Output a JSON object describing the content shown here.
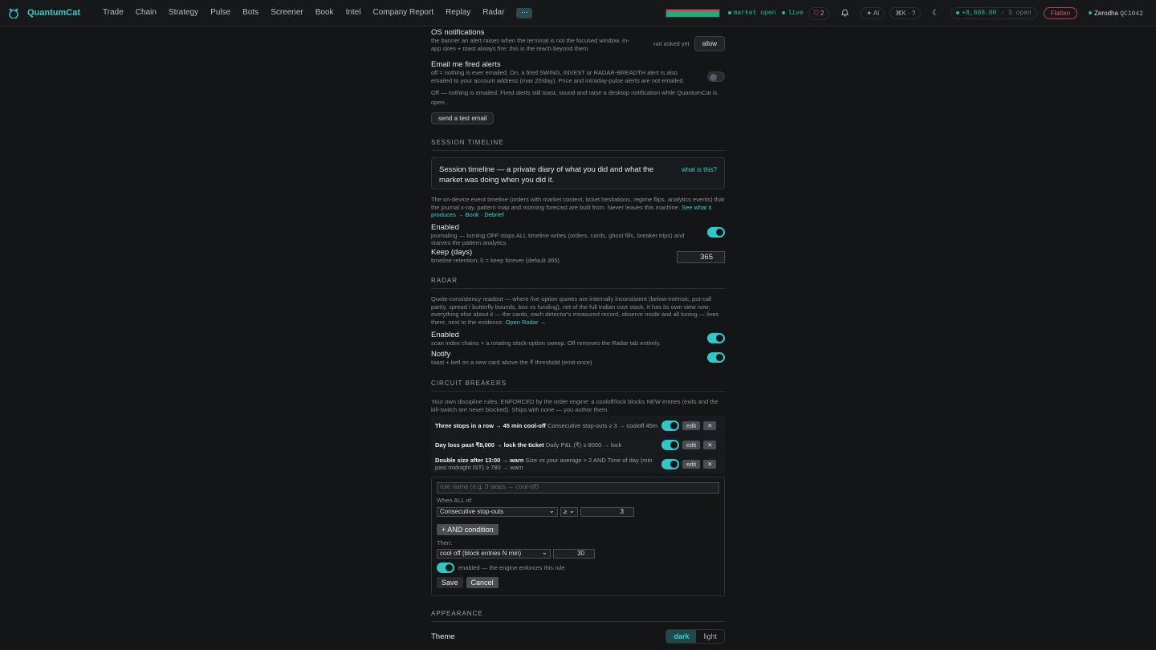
{
  "brand": "QuantumCat",
  "nav": [
    "Trade",
    "Chain",
    "Strategy",
    "Pulse",
    "Bots",
    "Screener",
    "Book",
    "Intel",
    "Company Report",
    "Replay",
    "Radar"
  ],
  "more": "···",
  "status": {
    "market": "market open",
    "live": "live",
    "alerts_count": "2",
    "ai": "✦ AI",
    "hk": "⌘K · ?",
    "pnl": "+8,888.00",
    "open": "· 3 open",
    "flatten": "Flatten",
    "broker": "Zerodha",
    "account": "QC1042"
  },
  "os": {
    "title": "OS notifications",
    "hint": "the banner an alert raises when the terminal is not the focused window. In-app siren + toast always fire; this is the reach beyond them.",
    "state": "not asked yet",
    "allow": "allow"
  },
  "email": {
    "title": "Email me fired alerts",
    "hint": "off = nothing is ever emailed. On, a fired SWING, INVEST or RADAR-BREADTH alert is also emailed to your account address (max 20/day). Price and intraday-pulse alerts are not emailed.",
    "off_note": "Off — nothing is emailed. Fired alerts still toast, sound and raise a desktop notification while QuantumCat is open.",
    "test": "send a test email"
  },
  "timeline": {
    "head": "Session Timeline",
    "callout": "Session timeline — a private diary of what you did and what the market was doing when you did it.",
    "what": "what is this?",
    "desc": "The on-device event timeline (orders with market context, ticket hesitations, regime flips, analytics events) that the journal x-ray, pattern map and morning forecast are built from. Never leaves this machine.",
    "see": "See what it produces → Book · Debrief",
    "enabled": "Enabled",
    "enabled_hint": "journaling — turning OFF stops ALL timeline writes (orders, cards, ghost fills, breaker trips) and starves the pattern analytics",
    "keep": "Keep (days)",
    "keep_hint": "timeline retention; 0 = keep forever (default 365)",
    "keep_value": "365"
  },
  "radar": {
    "head": "Radar",
    "desc": "Quote-consistency readout — where live option quotes are internally inconsistent (below-intrinsic, put-call parity, spread / butterfly bounds, box vs funding), net of the full Indian cost stack. It has its own view now; everything else about it — the cards, each detector's measured record, observe mode and all tuning — lives there, next to the evidence.",
    "open": "Open Radar →",
    "enabled": "Enabled",
    "enabled_hint": "scan index chains + a rotating stock-option sweep. Off removes the Radar tab entirely.",
    "notify": "Notify",
    "notify_hint": "toast + bell on a new card above the ₹ threshold (emit-once)"
  },
  "breakers": {
    "head": "Circuit Breakers",
    "desc": "Your own discipline rules, ENFORCED by the order engine: a cooloff/lock blocks NEW entries (exits and the kill-switch are never blocked). Ships with none — you author them.",
    "edit": "edit",
    "remove": "✕",
    "rules": [
      {
        "name": "Three stops in a row → 45 min cool-off",
        "desc": "Consecutive stop-outs ≥ 3 → cooloff 45m"
      },
      {
        "name": "Day loss past ₹8,000 → lock the ticket",
        "desc": "Daily P&L (₹) ≥ 8000 → lock"
      },
      {
        "name": "Double size after 13:00 → warn",
        "desc": "Size vs your average > 2 AND Time of day (min past midnight IST) ≥ 780 → warn"
      }
    ],
    "editor": {
      "placeholder": "rule name (e.g. 3 stops → cool-off)",
      "when": "When ALL of:",
      "metric": "Consecutive stop-outs",
      "op": "≥",
      "value": "3",
      "add": "+ AND condition",
      "then": "Then:",
      "action": "cool off (block entries N min)",
      "action_value": "30",
      "enabled_note": "enabled — the engine enforces this rule",
      "save": "Save",
      "cancel": "Cancel"
    }
  },
  "appearance": {
    "head": "Appearance",
    "theme": "Theme",
    "dark": "dark",
    "light": "light"
  },
  "colors": {
    "accent": "#2fd0d0",
    "danger": "#e0506a",
    "bg": "#141517"
  }
}
